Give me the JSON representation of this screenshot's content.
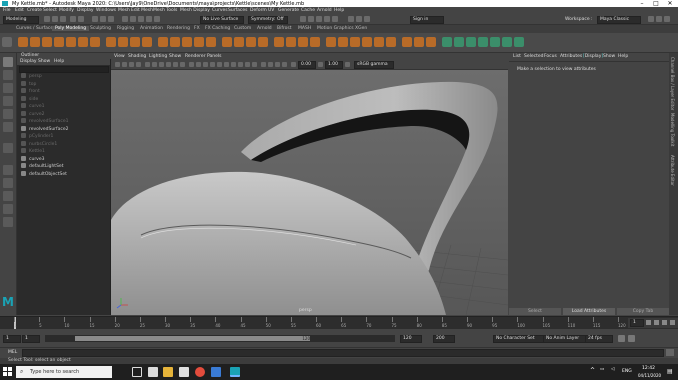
{
  "window": {
    "title": "My Kettle.mb* - Autodesk Maya 2020: C:\\Users\\Jay9\\OneDrive\\Documents\\maya\\projects\\Kettle\\scenes\\My Kettle.mb",
    "controls": [
      "–",
      "□",
      "✕"
    ]
  },
  "menubar": [
    "File",
    "Edit",
    "Create",
    "Select",
    "Modify",
    "Display",
    "Windows",
    "Mesh",
    "Edit Mesh",
    "Mesh Tools",
    "Mesh Display",
    "Curves",
    "Surfaces",
    "Deform",
    "UV",
    "Generate",
    "Cache",
    "Arnold",
    "Help"
  ],
  "statusline": {
    "menuset": "Modeling",
    "live_surface": "No Live Surface",
    "symmetry": "Symmetry: Off",
    "user": "Sign in",
    "workspace_label": "Workspace :",
    "workspace": "Maya Classic"
  },
  "shelf_tabs": [
    "Curves / Surfaces",
    "Poly Modeling",
    "Sculpting",
    "Rigging",
    "Animation",
    "Rendering",
    "FX",
    "FX Caching",
    "Custom",
    "Arnold",
    "Bifrost",
    "MASH",
    "Motion Graphics",
    "XGen"
  ],
  "active_shelf_tab": "Poly Modeling",
  "outliner": {
    "title": "Outliner",
    "menu": [
      "Display",
      "Show",
      "Help"
    ],
    "items": [
      {
        "label": "persp",
        "dim": true
      },
      {
        "label": "top",
        "dim": true
      },
      {
        "label": "front",
        "dim": true
      },
      {
        "label": "side",
        "dim": true
      },
      {
        "label": "curve1",
        "dim": true
      },
      {
        "label": "curve2",
        "dim": true
      },
      {
        "label": "revolvedSurface1",
        "dim": true
      },
      {
        "label": "revolvedSurface2",
        "dim": false
      },
      {
        "label": "pCylinder1",
        "dim": true
      },
      {
        "label": "nurbsCircle1",
        "dim": true
      },
      {
        "label": "Kettle1",
        "dim": true
      },
      {
        "label": "curve3",
        "dim": false
      },
      {
        "label": "defaultLightSet",
        "dim": false
      },
      {
        "label": "defaultObjectSet",
        "dim": false
      }
    ]
  },
  "viewport": {
    "menu": [
      "View",
      "Shading",
      "Lighting",
      "Show",
      "Renderer",
      "Panels"
    ],
    "exposure": "0.00",
    "gamma": "1.00",
    "colorspace": "sRGB gamma",
    "camera": "persp"
  },
  "attribute_editor": {
    "menu": [
      "List",
      "Selected",
      "Focus",
      "Attributes",
      "Display",
      "Show",
      "Help"
    ],
    "message": "Make a selection to view attributes",
    "buttons": [
      "Select",
      "Load Attributes",
      "Copy Tab"
    ]
  },
  "side_tabs": [
    "Channel Box / Layer Editor",
    "Modelling Toolkit",
    "Attribute Editor"
  ],
  "timeline": {
    "ticks": [
      "1",
      "5",
      "10",
      "15",
      "20",
      "25",
      "30",
      "35",
      "40",
      "45",
      "50",
      "55",
      "60",
      "65",
      "70",
      "75",
      "80",
      "85",
      "90",
      "95",
      "100",
      "105",
      "110",
      "115",
      "120"
    ],
    "current_frame": "1"
  },
  "range": {
    "start": "1",
    "inner_start": "1",
    "slider_end": "120",
    "inner_end": "120",
    "end": "200",
    "character_set": "No Character Set",
    "anim_layer": "No Anim Layer",
    "fps": "24 fps"
  },
  "command": {
    "lang": "MEL",
    "help": "Select Tool: select an object"
  },
  "taskbar": {
    "search_placeholder": "Type here to search",
    "language": "ENG",
    "time": "12:42",
    "date": "04/11/2020"
  },
  "colors": {
    "shelf_icon": "#b86b28",
    "accent_teal": "#5fd0d0",
    "maya_logo": "#1aa3b5"
  }
}
